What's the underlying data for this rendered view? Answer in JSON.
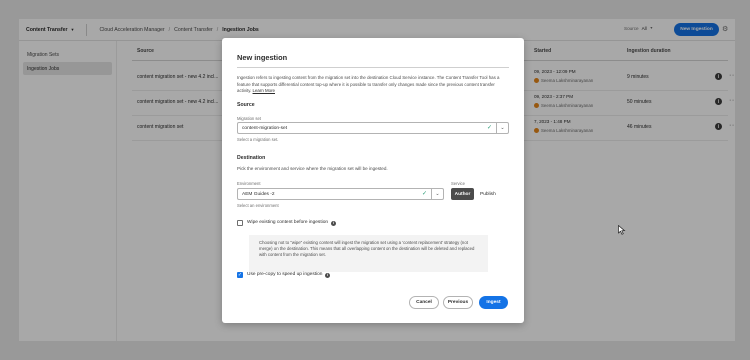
{
  "app": {
    "product_dropdown": "Content Transfer",
    "breadcrumb": [
      "Cloud Acceleration Manager",
      "Content Transfer",
      "Ingestion Jobs"
    ],
    "source_filter_label": "Source",
    "source_filter_value": "All",
    "new_ingestion_button": "New Ingestion",
    "icons": [
      "chevron-down-icon",
      "gear-icon",
      "info-icon",
      "more-icon"
    ]
  },
  "sidebar": {
    "items": [
      {
        "label": "Migration Sets",
        "active": false
      },
      {
        "label": "Ingestion Jobs",
        "active": true
      }
    ]
  },
  "table": {
    "columns": {
      "source": "Source",
      "started": "Started",
      "duration": "Ingestion duration"
    },
    "rows": [
      {
        "source": "content migration set - new 4.2 incl...",
        "started": "09, 2023 - 12:09 PM",
        "user": "Seema Lakshminarayanan",
        "duration": "9 minutes"
      },
      {
        "source": "content migration set - new 4.2 incl...",
        "started": "09, 2023 - 2:37 PM",
        "user": "Seema Lakshminarayanan",
        "duration": "50 minutes"
      },
      {
        "source": "content migration set",
        "started": "7, 2023 - 1:48 PM",
        "user": "Seema Lakshminarayanan",
        "duration": "46 minutes"
      }
    ]
  },
  "dialog": {
    "title": "New ingestion",
    "intro": "Ingestion refers to ingesting content from the migration set into the destination Cloud Service instance. The Content Transfer Tool has a feature that supports differential content top-up where it is possible to transfer only changes made since the previous content transfer activity.",
    "learn_more": "Learn More",
    "source": {
      "heading": "Source",
      "field_label": "Migration set",
      "value": "content-migration-set",
      "help": "Select a migration set."
    },
    "destination": {
      "heading": "Destination",
      "description": "Pick the environment and service where the migration set will be ingested.",
      "env_label": "Environment",
      "env_value": "AEM Guides -2",
      "env_help": "Select an environment",
      "service_label": "Service",
      "service_options": [
        "Author",
        "Publish"
      ],
      "service_selected": "Author"
    },
    "wipe": {
      "label": "Wipe existing content before ingestion",
      "checked": false,
      "note": "Choosing not to \"wipe\" existing content will ingest the migration set using a 'content replacement' strategy (not merge) on the destination. This means that all overlapping content on the destination will be deleted and replaced with content from the migration set."
    },
    "precopy": {
      "label": "Use pre-copy to speed up ingestion",
      "checked": true
    },
    "buttons": {
      "cancel": "Cancel",
      "previous": "Previous",
      "ingest": "Ingest"
    }
  },
  "colors": {
    "accent": "#1473e6",
    "valid": "#2d9d78",
    "author_selected": "#4b4b4b"
  }
}
